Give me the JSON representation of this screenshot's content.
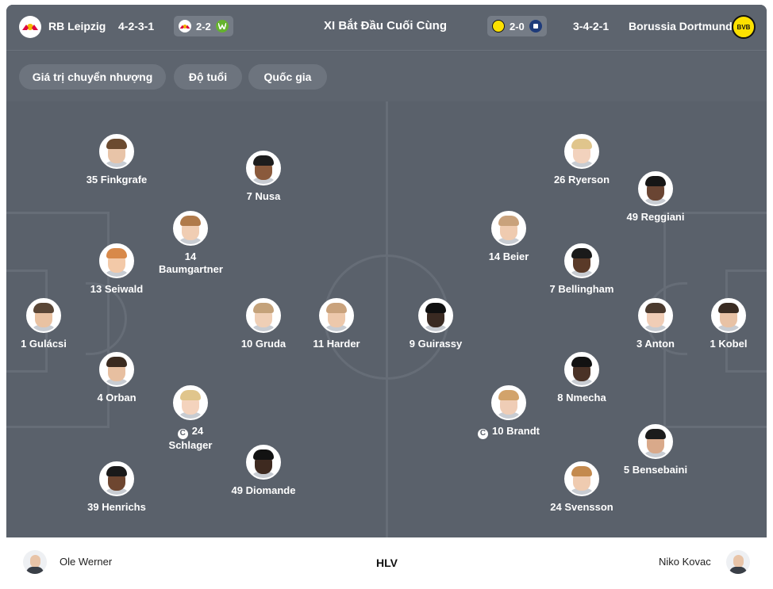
{
  "header": {
    "home_team": "RB Leipzig",
    "home_formation": "4-2-3-1",
    "home_last_score": "2-2",
    "title": "XI Bắt Đầu Cuối Cùng",
    "away_last_score": "2-0",
    "away_formation": "3-4-2-1",
    "away_team": "Borussia Dortmund",
    "away_logo_text": "BVB"
  },
  "filters": [
    "Giá trị chuyển nhượng",
    "Độ tuổi",
    "Quốc gia"
  ],
  "home_players": [
    {
      "label": "35 Finkgrafe",
      "captain": false
    },
    {
      "label": "7 Nusa",
      "captain": false
    },
    {
      "label": "14 Baumgartner",
      "captain": false
    },
    {
      "label": "13 Seiwald",
      "captain": false
    },
    {
      "label": "1 Gulácsi",
      "captain": false
    },
    {
      "label": "10 Gruda",
      "captain": false
    },
    {
      "label": "11 Harder",
      "captain": false
    },
    {
      "label": "4 Orban",
      "captain": false
    },
    {
      "label": "24 Schlager",
      "captain": true
    },
    {
      "label": "49 Diomande",
      "captain": false
    },
    {
      "label": "39 Henrichs",
      "captain": false
    }
  ],
  "away_players": [
    {
      "label": "26 Ryerson",
      "captain": false
    },
    {
      "label": "49 Reggiani",
      "captain": false
    },
    {
      "label": "14 Beier",
      "captain": false
    },
    {
      "label": "7 Bellingham",
      "captain": false
    },
    {
      "label": "9 Guirassy",
      "captain": false
    },
    {
      "label": "3 Anton",
      "captain": false
    },
    {
      "label": "1 Kobel",
      "captain": false
    },
    {
      "label": "8 Nmecha",
      "captain": false
    },
    {
      "label": "10 Brandt",
      "captain": true
    },
    {
      "label": "5 Bensebaini",
      "captain": false
    },
    {
      "label": "24 Svensson",
      "captain": false
    }
  ],
  "captain_mark": "C",
  "coaches": {
    "home": "Ole Werner",
    "label": "HLV",
    "away": "Niko Kovac"
  },
  "colors": {
    "pitch": "#5a616b",
    "leipzig_red": "#dd0741",
    "wolfsburg_green": "#65b32e",
    "bvb_yellow": "#fde100"
  }
}
